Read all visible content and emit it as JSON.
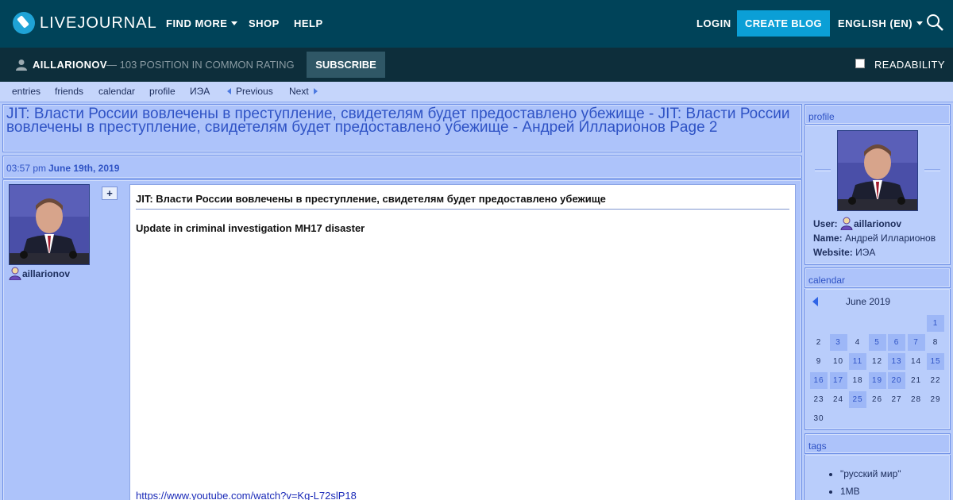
{
  "topbar": {
    "logo_text": "LIVEJOURNAL",
    "nav": {
      "find_more": "FIND MORE",
      "shop": "SHOP",
      "help": "HELP"
    },
    "login": "LOGIN",
    "create_blog": "CREATE BLOG",
    "language": "ENGLISH (EN)"
  },
  "userbar": {
    "username": "AILLARIONOV",
    "rating": "— 103 POSITION IN COMMON RATING",
    "subscribe": "SUBSCRIBE",
    "readability": "READABILITY"
  },
  "journal_nav": {
    "entries": "entries",
    "friends": "friends",
    "calendar": "calendar",
    "profile": "profile",
    "iea": "ИЭА",
    "previous": "Previous",
    "next": "Next"
  },
  "page_title": "JIT: Власти России вовлечены в преступление, свидетелям будет предоставлено убежище - JIT: Власти России вовлечены в преступление, свидетелям будет предоставлено убежище - Андрей Илларионов Page 2",
  "entry": {
    "time": "03:57 pm",
    "date": "June 19th, 2019",
    "author": "aillarionov",
    "subject": "JIT: Власти России вовлечены в преступление, свидетелям будет предоставлено убежище",
    "line": "Update in criminal investigation MH17 disaster",
    "link": "https://www.youtube.com/watch?v=Kg-L72slP18"
  },
  "sidebar": {
    "profile": {
      "header": "profile",
      "user_label": "User:",
      "user_value": "aillarionov",
      "name_label": "Name:",
      "name_value": "Андрей Илларионов",
      "website_label": "Website:",
      "website_value": "ИЭА"
    },
    "calendar": {
      "header": "calendar",
      "month": "June 2019",
      "days": [
        "1",
        "2",
        "3",
        "4",
        "5",
        "6",
        "7",
        "8",
        "9",
        "10",
        "11",
        "12",
        "13",
        "14",
        "15",
        "16",
        "17",
        "18",
        "19",
        "20",
        "21",
        "22",
        "23",
        "24",
        "25",
        "26",
        "27",
        "28",
        "29",
        "30"
      ],
      "highlighted_days": [
        "1",
        "3",
        "5",
        "6",
        "7",
        "11",
        "13",
        "15",
        "16",
        "17",
        "19",
        "20",
        "25"
      ]
    },
    "tags": {
      "header": "tags",
      "items": [
        "\"русский мир\"",
        "1МВ"
      ]
    }
  },
  "colors": {
    "topbar": "#004359",
    "userbar": "#0d2e3b",
    "accent": "#0b9fd6",
    "page_bg": "#b7cbfa",
    "link": "#2f53c5"
  }
}
